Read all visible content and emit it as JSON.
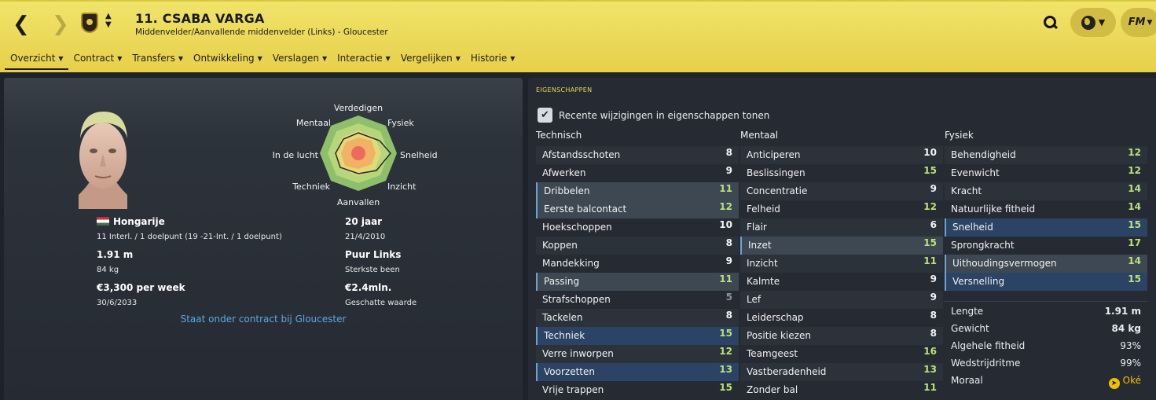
{
  "header": {
    "title": "11. CSABA VARGA",
    "subtitle": "Middenvelder/Aanvallende middenvelder (Links) - Gloucester",
    "back_icon": "chevron-left-icon",
    "forward_icon": "chevron-right-icon",
    "tabs": [
      {
        "label": "Overzicht",
        "active": true
      },
      {
        "label": "Contract"
      },
      {
        "label": "Transfers"
      },
      {
        "label": "Ontwikkeling"
      },
      {
        "label": "Verslagen"
      },
      {
        "label": "Interactie"
      },
      {
        "label": "Vergelijken"
      },
      {
        "label": "Historie"
      }
    ],
    "fm_label": "FM"
  },
  "overview": {
    "radar_labels": {
      "top": "Verdedigen",
      "top_right": "Fysiek",
      "right": "Snelheid",
      "bottom_right": "Inzicht",
      "bottom": "Aanvallen",
      "bottom_left": "Techniek",
      "left": "In de lucht",
      "top_left": "Mentaal"
    },
    "nationality": "Hongarije",
    "caps": "11 Interl. / 1 doelpunt (19 -21-Int. / 1 doelpunt)",
    "age": "20 jaar",
    "birthdate": "21/4/2010",
    "height": "1.91 m",
    "weight": "84 kg",
    "foot": "Puur Links",
    "foot_label": "Sterkste been",
    "wage": "€3,300 per week",
    "contract_end": "30/6/2033",
    "value": "€2.4mln.",
    "value_label": "Geschatte waarde",
    "contract_status": "Staat onder contract bij Gloucester"
  },
  "attributes": {
    "section_title": "EIGENSCHAPPEN",
    "toggle_label": "Recente wijzigingen in eigenschappen tonen",
    "toggle_checked": true,
    "technical_header": "Technisch",
    "mental_header": "Mentaal",
    "physical_header": "Fysiek",
    "technical": [
      {
        "name": "Afstandsschoten",
        "value": "8"
      },
      {
        "name": "Afwerken",
        "value": "9"
      },
      {
        "name": "Dribbelen",
        "value": "11"
      },
      {
        "name": "Eerste balcontact",
        "value": "12"
      },
      {
        "name": "Hoekschoppen",
        "value": "10"
      },
      {
        "name": "Koppen",
        "value": "8"
      },
      {
        "name": "Mandekking",
        "value": "9"
      },
      {
        "name": "Passing",
        "value": "11"
      },
      {
        "name": "Strafschoppen",
        "value": "5"
      },
      {
        "name": "Tackelen",
        "value": "8"
      },
      {
        "name": "Techniek",
        "value": "15"
      },
      {
        "name": "Verre inworpen",
        "value": "12"
      },
      {
        "name": "Voorzetten",
        "value": "13"
      },
      {
        "name": "Vrije trappen",
        "value": "15"
      }
    ],
    "mental": [
      {
        "name": "Anticiperen",
        "value": "10"
      },
      {
        "name": "Beslissingen",
        "value": "15"
      },
      {
        "name": "Concentratie",
        "value": "9"
      },
      {
        "name": "Felheid",
        "value": "12"
      },
      {
        "name": "Flair",
        "value": "6"
      },
      {
        "name": "Inzet",
        "value": "15"
      },
      {
        "name": "Inzicht",
        "value": "11"
      },
      {
        "name": "Kalmte",
        "value": "9"
      },
      {
        "name": "Lef",
        "value": "9"
      },
      {
        "name": "Leiderschap",
        "value": "8"
      },
      {
        "name": "Positie kiezen",
        "value": "8"
      },
      {
        "name": "Teamgeest",
        "value": "16"
      },
      {
        "name": "Vastberadenheid",
        "value": "13"
      },
      {
        "name": "Zonder bal",
        "value": "11"
      }
    ],
    "physical": [
      {
        "name": "Behendigheid",
        "value": "12"
      },
      {
        "name": "Evenwicht",
        "value": "12"
      },
      {
        "name": "Kracht",
        "value": "14"
      },
      {
        "name": "Natuurlijke fitheid",
        "value": "14"
      },
      {
        "name": "Snelheid",
        "value": "15"
      },
      {
        "name": "Sprongkracht",
        "value": "17"
      },
      {
        "name": "Uithoudingsvermogen",
        "value": "14"
      },
      {
        "name": "Versnelling",
        "value": "15"
      }
    ],
    "stats": [
      {
        "name": "Lengte",
        "value": "1.91 m"
      },
      {
        "name": "Gewicht",
        "value": "84 kg"
      },
      {
        "name": "Algehele fitheid",
        "value": "93%"
      },
      {
        "name": "Wedstrijdritme",
        "value": "99%"
      },
      {
        "name": "Moraal",
        "value": "Oké"
      }
    ]
  },
  "colors": {
    "header_yellow": "#e9d552",
    "attr_green": "#b9e27a",
    "link_blue": "#5aa7e3",
    "accent_gold": "#e7d45a"
  }
}
